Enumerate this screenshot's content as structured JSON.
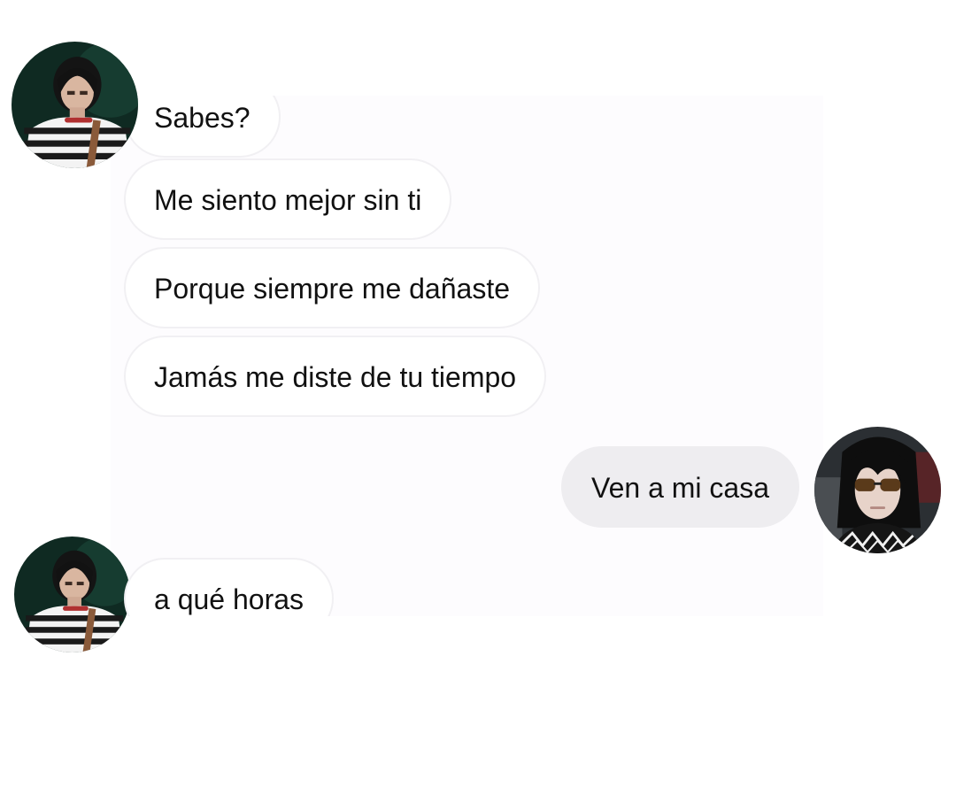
{
  "conversation": {
    "messages": [
      {
        "from": "other",
        "text": "Sabes?"
      },
      {
        "from": "other",
        "text": "Me siento mejor sin ti"
      },
      {
        "from": "other",
        "text": "Porque siempre me dañaste"
      },
      {
        "from": "other",
        "text": "Jamás me diste de tu tiempo"
      },
      {
        "from": "me",
        "text": "Ven a mi casa"
      },
      {
        "from": "other",
        "text": "a qué horas"
      }
    ]
  },
  "avatars": {
    "other": {
      "icon": "person-striped-shirt-avatar",
      "bg": "#0f2a22"
    },
    "me": {
      "icon": "person-sunglasses-avatar",
      "bg": "#2b2f33"
    }
  },
  "colors": {
    "received_bubble": "#ffffff",
    "received_border": "#f1f0f3",
    "sent_bubble": "#eeedf0",
    "panel_bg": "#fdfcfe",
    "text": "#111111"
  }
}
